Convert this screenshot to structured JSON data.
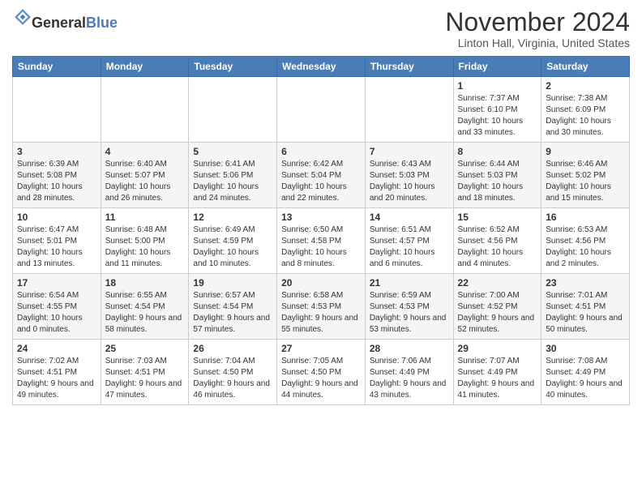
{
  "header": {
    "logo_general": "General",
    "logo_blue": "Blue",
    "month_title": "November 2024",
    "location": "Linton Hall, Virginia, United States"
  },
  "weekdays": [
    "Sunday",
    "Monday",
    "Tuesday",
    "Wednesday",
    "Thursday",
    "Friday",
    "Saturday"
  ],
  "weeks": [
    [
      {
        "day": "",
        "info": ""
      },
      {
        "day": "",
        "info": ""
      },
      {
        "day": "",
        "info": ""
      },
      {
        "day": "",
        "info": ""
      },
      {
        "day": "",
        "info": ""
      },
      {
        "day": "1",
        "info": "Sunrise: 7:37 AM\nSunset: 6:10 PM\nDaylight: 10 hours and 33 minutes."
      },
      {
        "day": "2",
        "info": "Sunrise: 7:38 AM\nSunset: 6:09 PM\nDaylight: 10 hours and 30 minutes."
      }
    ],
    [
      {
        "day": "3",
        "info": "Sunrise: 6:39 AM\nSunset: 5:08 PM\nDaylight: 10 hours and 28 minutes."
      },
      {
        "day": "4",
        "info": "Sunrise: 6:40 AM\nSunset: 5:07 PM\nDaylight: 10 hours and 26 minutes."
      },
      {
        "day": "5",
        "info": "Sunrise: 6:41 AM\nSunset: 5:06 PM\nDaylight: 10 hours and 24 minutes."
      },
      {
        "day": "6",
        "info": "Sunrise: 6:42 AM\nSunset: 5:04 PM\nDaylight: 10 hours and 22 minutes."
      },
      {
        "day": "7",
        "info": "Sunrise: 6:43 AM\nSunset: 5:03 PM\nDaylight: 10 hours and 20 minutes."
      },
      {
        "day": "8",
        "info": "Sunrise: 6:44 AM\nSunset: 5:03 PM\nDaylight: 10 hours and 18 minutes."
      },
      {
        "day": "9",
        "info": "Sunrise: 6:46 AM\nSunset: 5:02 PM\nDaylight: 10 hours and 15 minutes."
      }
    ],
    [
      {
        "day": "10",
        "info": "Sunrise: 6:47 AM\nSunset: 5:01 PM\nDaylight: 10 hours and 13 minutes."
      },
      {
        "day": "11",
        "info": "Sunrise: 6:48 AM\nSunset: 5:00 PM\nDaylight: 10 hours and 11 minutes."
      },
      {
        "day": "12",
        "info": "Sunrise: 6:49 AM\nSunset: 4:59 PM\nDaylight: 10 hours and 10 minutes."
      },
      {
        "day": "13",
        "info": "Sunrise: 6:50 AM\nSunset: 4:58 PM\nDaylight: 10 hours and 8 minutes."
      },
      {
        "day": "14",
        "info": "Sunrise: 6:51 AM\nSunset: 4:57 PM\nDaylight: 10 hours and 6 minutes."
      },
      {
        "day": "15",
        "info": "Sunrise: 6:52 AM\nSunset: 4:56 PM\nDaylight: 10 hours and 4 minutes."
      },
      {
        "day": "16",
        "info": "Sunrise: 6:53 AM\nSunset: 4:56 PM\nDaylight: 10 hours and 2 minutes."
      }
    ],
    [
      {
        "day": "17",
        "info": "Sunrise: 6:54 AM\nSunset: 4:55 PM\nDaylight: 10 hours and 0 minutes."
      },
      {
        "day": "18",
        "info": "Sunrise: 6:55 AM\nSunset: 4:54 PM\nDaylight: 9 hours and 58 minutes."
      },
      {
        "day": "19",
        "info": "Sunrise: 6:57 AM\nSunset: 4:54 PM\nDaylight: 9 hours and 57 minutes."
      },
      {
        "day": "20",
        "info": "Sunrise: 6:58 AM\nSunset: 4:53 PM\nDaylight: 9 hours and 55 minutes."
      },
      {
        "day": "21",
        "info": "Sunrise: 6:59 AM\nSunset: 4:53 PM\nDaylight: 9 hours and 53 minutes."
      },
      {
        "day": "22",
        "info": "Sunrise: 7:00 AM\nSunset: 4:52 PM\nDaylight: 9 hours and 52 minutes."
      },
      {
        "day": "23",
        "info": "Sunrise: 7:01 AM\nSunset: 4:51 PM\nDaylight: 9 hours and 50 minutes."
      }
    ],
    [
      {
        "day": "24",
        "info": "Sunrise: 7:02 AM\nSunset: 4:51 PM\nDaylight: 9 hours and 49 minutes."
      },
      {
        "day": "25",
        "info": "Sunrise: 7:03 AM\nSunset: 4:51 PM\nDaylight: 9 hours and 47 minutes."
      },
      {
        "day": "26",
        "info": "Sunrise: 7:04 AM\nSunset: 4:50 PM\nDaylight: 9 hours and 46 minutes."
      },
      {
        "day": "27",
        "info": "Sunrise: 7:05 AM\nSunset: 4:50 PM\nDaylight: 9 hours and 44 minutes."
      },
      {
        "day": "28",
        "info": "Sunrise: 7:06 AM\nSunset: 4:49 PM\nDaylight: 9 hours and 43 minutes."
      },
      {
        "day": "29",
        "info": "Sunrise: 7:07 AM\nSunset: 4:49 PM\nDaylight: 9 hours and 41 minutes."
      },
      {
        "day": "30",
        "info": "Sunrise: 7:08 AM\nSunset: 4:49 PM\nDaylight: 9 hours and 40 minutes."
      }
    ]
  ]
}
